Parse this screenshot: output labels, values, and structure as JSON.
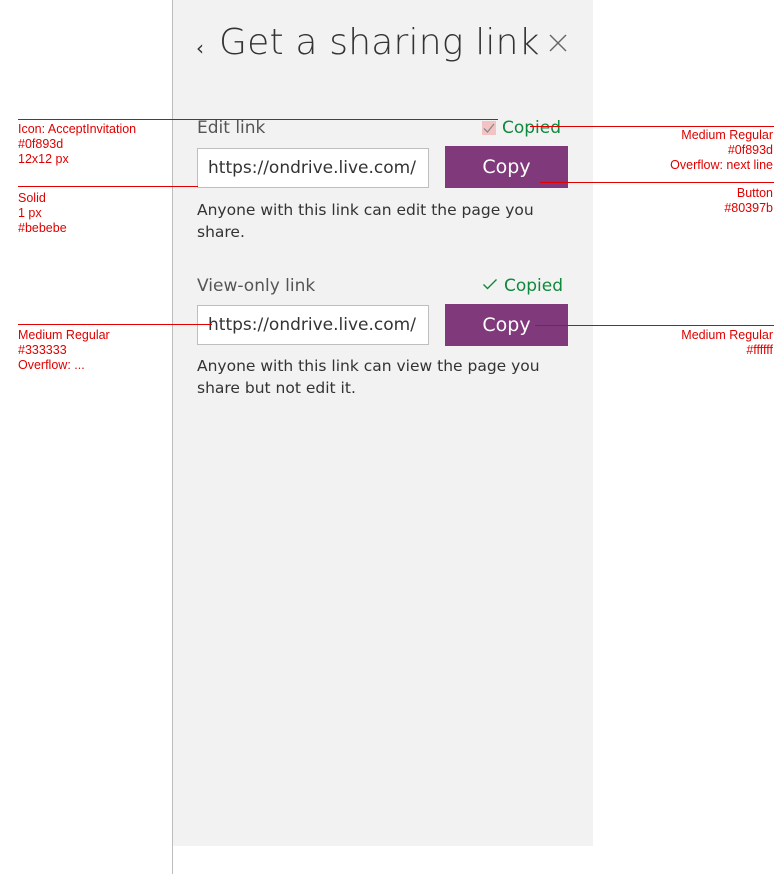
{
  "panel": {
    "back_glyph": "‹",
    "title": "Get a sharing link",
    "close_icon": "close-icon"
  },
  "edit": {
    "label": "Edit link",
    "copied": "Copied",
    "url": "https://ondrive.live.com/",
    "copy_label": "Copy",
    "description": "Anyone with this link can edit the page you share."
  },
  "view": {
    "label": "View-only link",
    "copied": "Copied",
    "url": "https://ondrive.live.com/",
    "copy_label": "Copy",
    "description": "Anyone with this link can view the page you share but not edit it."
  },
  "colors": {
    "accent_green": "#0f893d",
    "button": "#80397b",
    "border": "#bebebe",
    "text": "#333333",
    "annotation": "#e00000"
  },
  "annotations": {
    "icon_spec": [
      "Icon: AcceptInvitation",
      "#0f893d",
      "12x12 px"
    ],
    "border_spec": [
      "Solid",
      "1 px",
      "#bebebe"
    ],
    "url_text_spec": [
      "Medium Regular",
      "#333333",
      "Overflow: ..."
    ],
    "copied_text_spec": [
      "Medium Regular",
      "#0f893d",
      "Overflow: next line"
    ],
    "button_spec": [
      "Button",
      "#80397b"
    ],
    "button_text_spec": [
      "Medium Regular",
      "#ffffff"
    ]
  }
}
